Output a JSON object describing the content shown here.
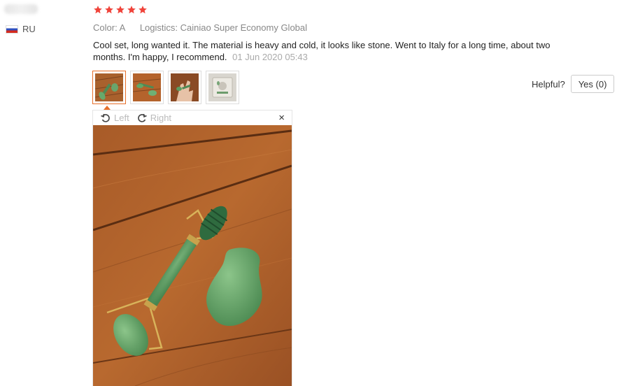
{
  "user": {
    "country_code": "RU"
  },
  "rating": {
    "stars": 5,
    "color": "#f0433a"
  },
  "meta": {
    "color_label": "Color:",
    "color_value": "A",
    "logistics_label": "Logistics:",
    "logistics_value": "Cainiao Super Economy Global"
  },
  "review": {
    "text": "Cool set, long wanted it. The material is heavy and cold, it looks like stone. Went to Italy for a long time, about two months. I'm happy, I recommend.",
    "date": "01 Jun 2020 05:43"
  },
  "viewer": {
    "left_label": "Left",
    "right_label": "Right",
    "close_glyph": "×"
  },
  "helpful": {
    "label": "Helpful?",
    "yes_label": "Yes (0)"
  },
  "colors": {
    "accent": "#e76f2a",
    "wood": "#b5642c",
    "jade": "#5f9c62"
  },
  "icons": [
    "russia-flag-icon",
    "star-icon",
    "rotate-left-icon",
    "rotate-right-icon",
    "close-icon"
  ]
}
